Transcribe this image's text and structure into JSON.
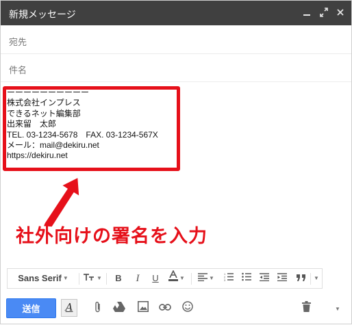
{
  "window": {
    "title": "新規メッセージ",
    "minimize_icon": "minimize-icon",
    "expand_icon": "expand-icon",
    "close_icon": "close-icon"
  },
  "fields": {
    "to_label": "宛先",
    "subject_label": "件名"
  },
  "signature": {
    "lines": [
      "ーーーーーーーーーー",
      "株式会社インプレス",
      "できるネット編集部",
      "出来留　太郎",
      "TEL. 03-1234-5678　FAX. 03-1234-567X",
      "メール：mail@dekiru.net",
      "https://dekiru.net"
    ]
  },
  "annotation": {
    "text": "社外向けの署名を入力",
    "color": "#e6101a"
  },
  "toolbar": {
    "font_label": "Sans Serif",
    "size_icon": "text-size-icon",
    "bold_label": "B",
    "italic_label": "I",
    "underline_label": "U",
    "text_color_icon": "text-color-icon",
    "align_icon": "align-icon",
    "numbered_list_icon": "numbered-list-icon",
    "bulleted_list_icon": "bulleted-list-icon",
    "indent_less_icon": "indent-less-icon",
    "indent_more_icon": "indent-more-icon",
    "quote_icon": "quote-icon",
    "more_icon": "chevron-down-icon"
  },
  "bottom": {
    "send_label": "送信",
    "format_icon": "formatting-options-icon",
    "attach_icon": "paperclip-icon",
    "drive_icon": "drive-icon",
    "photo_icon": "photo-icon",
    "link_icon": "link-icon",
    "emoji_icon": "emoji-icon",
    "discard_icon": "trash-icon",
    "more_options_icon": "chevron-down-icon"
  },
  "colors": {
    "titlebar": "#404040",
    "send_button": "#4a8af4",
    "highlight": "#e6101a"
  }
}
